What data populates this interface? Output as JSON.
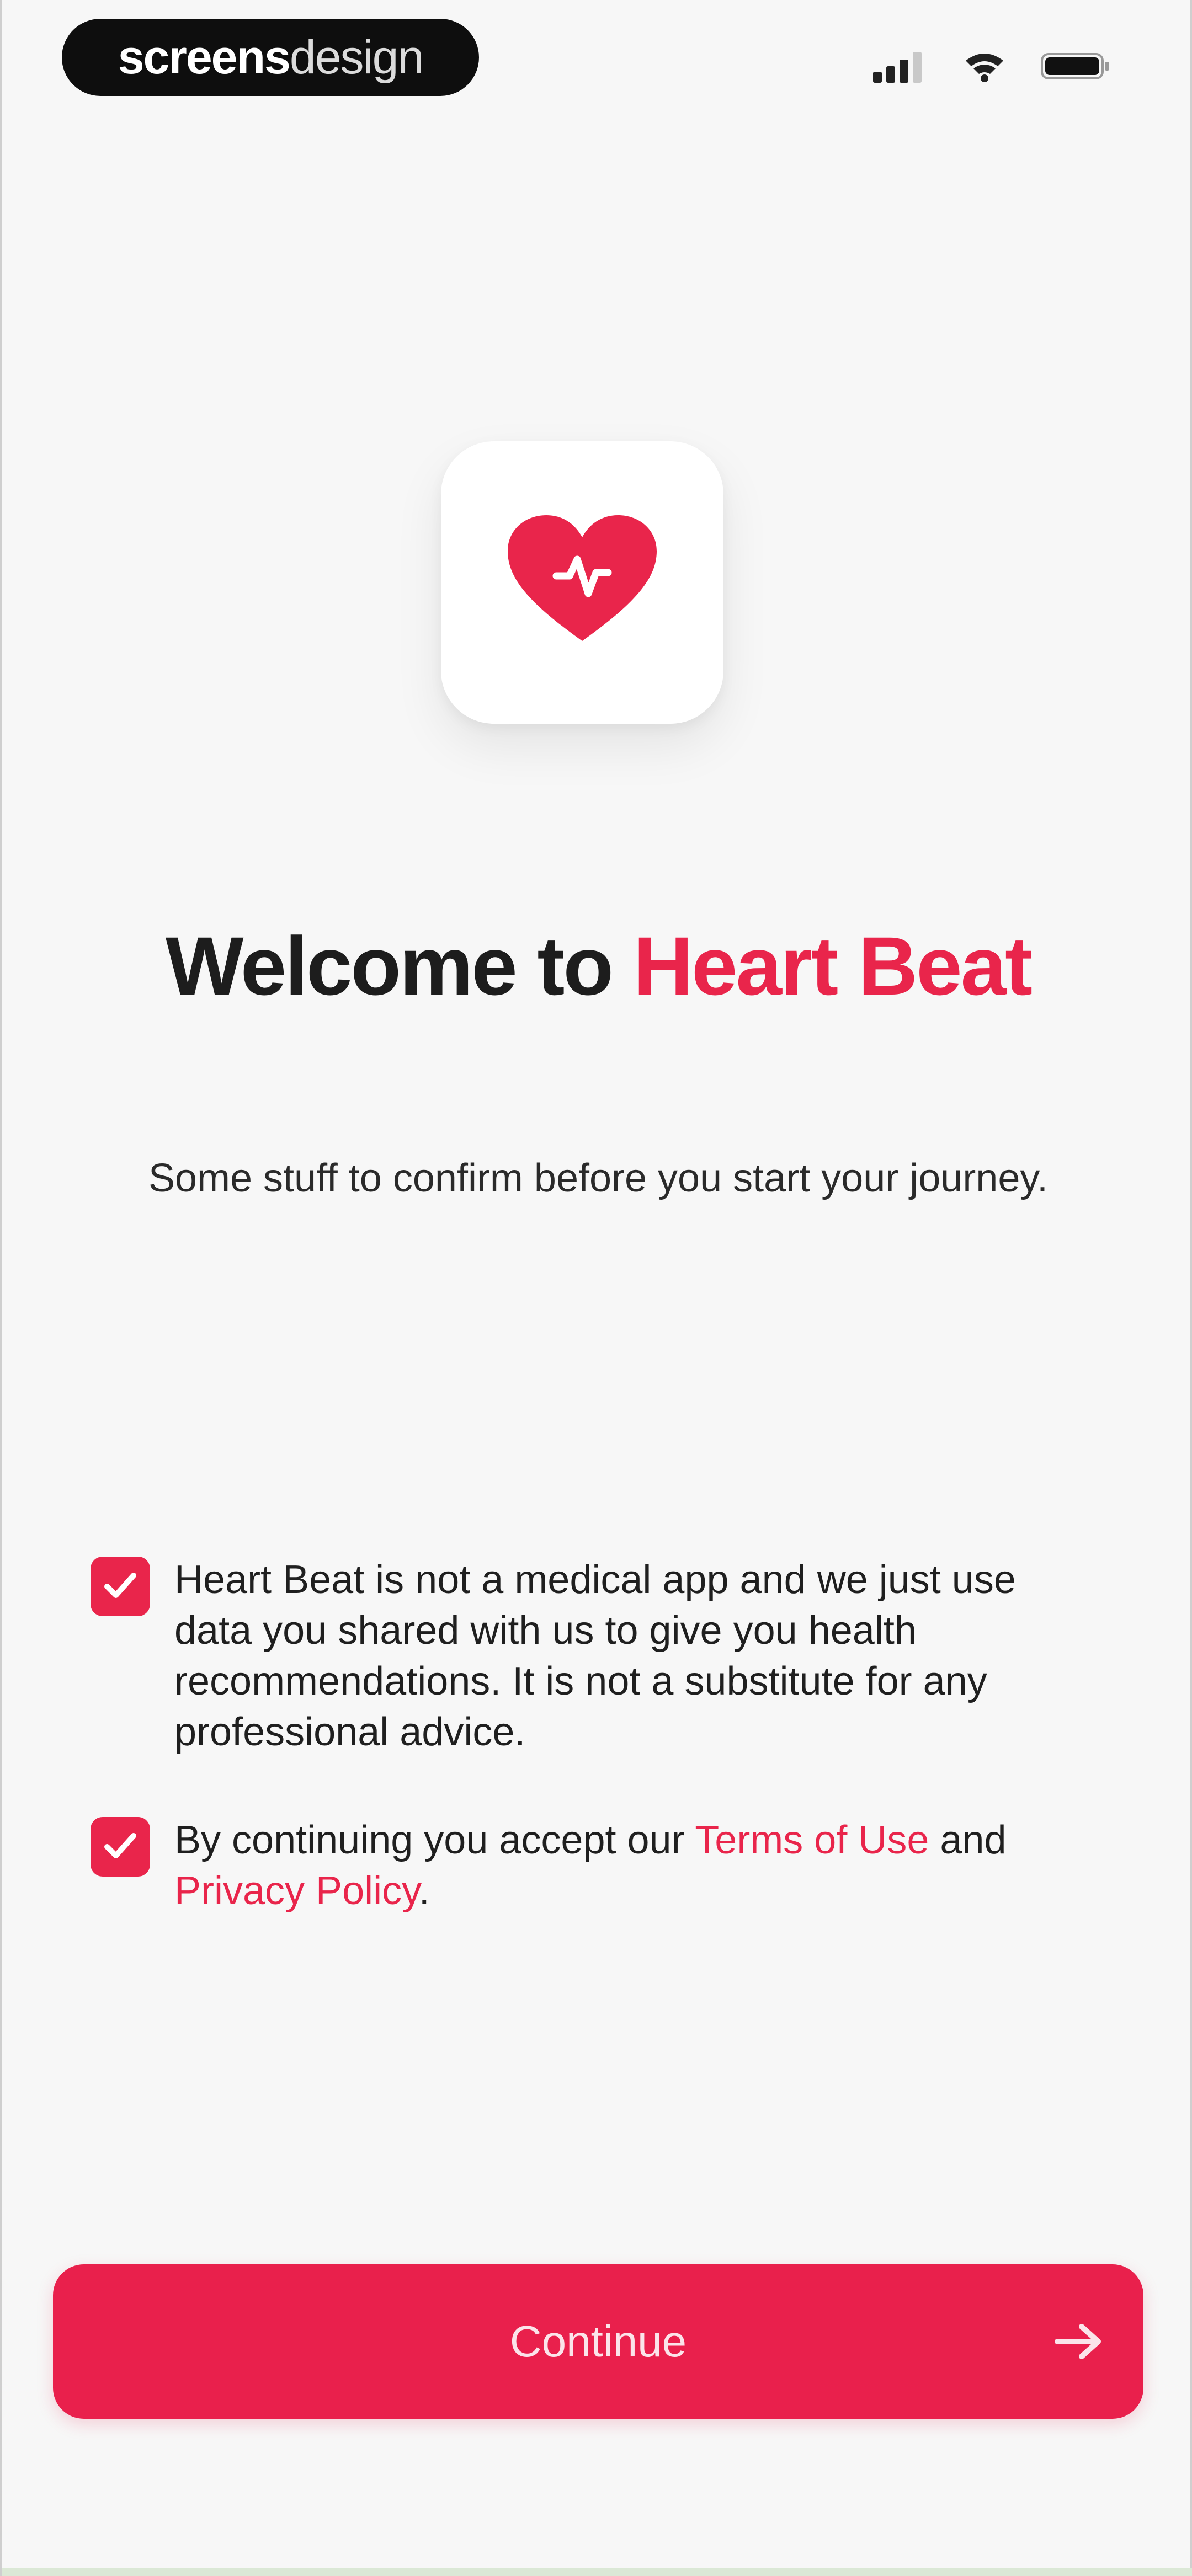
{
  "status_bar": {
    "brand_strong": "screens",
    "brand_light": "design",
    "icons": [
      "cellular-signal-icon",
      "wifi-icon",
      "battery-icon"
    ]
  },
  "app_icon": {
    "icon": "heart-pulse-icon",
    "accent_color": "#e9254b"
  },
  "welcome": {
    "title_prefix": "Welcome to ",
    "title_accent": "Heart Beat",
    "subtitle": "Some stuff to confirm before you start your journey."
  },
  "consents": {
    "medical_disclaimer": {
      "checked": true,
      "text": "Heart Beat is not a medical app and we just use data you shared with us to give you health recommendations. It is not a substitute for any professional advice."
    },
    "terms": {
      "checked": true,
      "text_before": "By continuing you accept our ",
      "terms_link": "Terms of Use",
      "text_middle": " and",
      "privacy_link": "Privacy Policy",
      "text_after": "."
    }
  },
  "continue_button": {
    "label": "Continue",
    "icon": "arrow-right-icon"
  },
  "colors": {
    "accent": "#e9254b",
    "background": "#f7f7f7",
    "text": "#1d1d1d"
  }
}
